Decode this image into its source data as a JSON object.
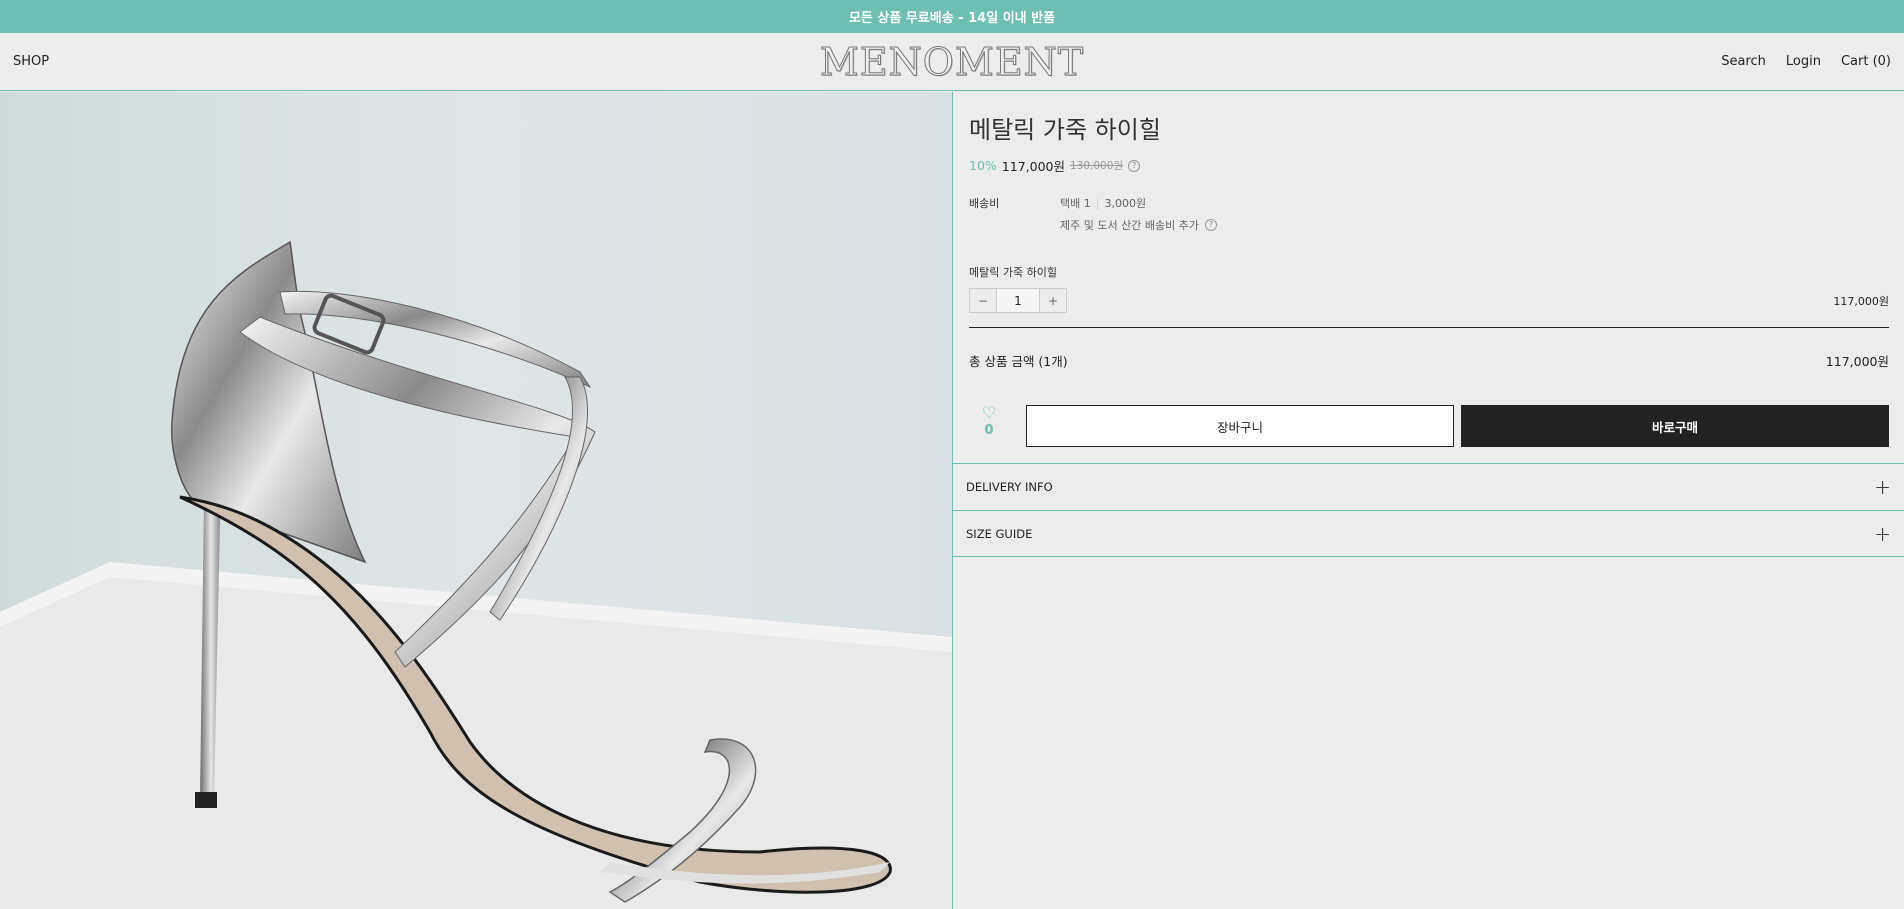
{
  "announcement": "모든 상품 무료배송 - 14일 이내 반품",
  "header": {
    "shop": "SHOP",
    "logo": "MENOMENT",
    "search": "Search",
    "login": "Login",
    "cart": "Cart (0)"
  },
  "product": {
    "title": "메탈릭 가죽 하이힐",
    "discount": "10%",
    "price": "117,000원",
    "original_price": "130,000원",
    "shipping_label": "배송비",
    "shipping_method": "택배 1",
    "shipping_fee": "3,000원",
    "shipping_note": "제주 및 도서 산간 배송비 추가",
    "option_name": "메탈릭 가죽 하이힐",
    "quantity": "1",
    "minus": "−",
    "plus": "+",
    "option_price": "117,000원",
    "total_label": "총 상품 금액 (1개)",
    "total_value": "117,000원",
    "likes": "0",
    "cart_button": "장바구니",
    "buy_button": "바로구매",
    "help_glyph": "?"
  },
  "accordion": [
    {
      "label": "DELIVERY INFO",
      "icon": "+"
    },
    {
      "label": "SIZE GUIDE",
      "icon": "+"
    }
  ],
  "colors": {
    "accent": "#6cbfb1",
    "dark": "#222222"
  },
  "icons": {
    "like": "heart-outline-icon",
    "help": "question-circle-icon",
    "expand": "plus-icon"
  }
}
